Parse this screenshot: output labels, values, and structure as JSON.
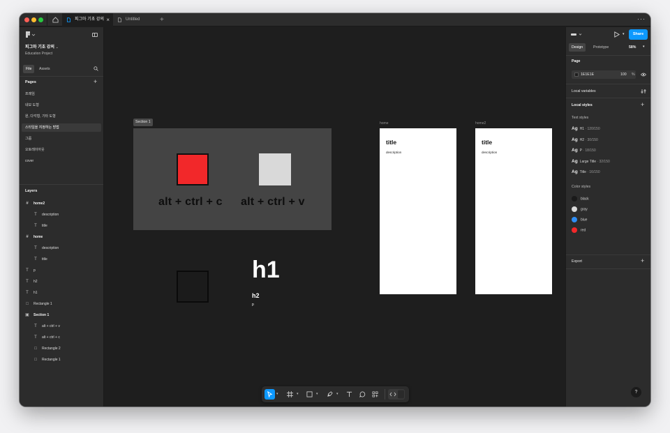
{
  "tabs": {
    "active_title": "피그마 기초 강의",
    "inactive_title": "Untitled",
    "add": "+",
    "close": "×",
    "more": "···"
  },
  "left": {
    "file_name": "피그마 기초 강의",
    "project": "Education Project",
    "file_tab": "File",
    "assets_tab": "Assets",
    "pages_title": "Pages",
    "pages": [
      "프레임",
      "네모 도형",
      "원, 다각형, 기타 도형",
      "스타일을 지정하는 방법",
      "그룹",
      "오토레이아웃",
      "cover"
    ],
    "selected_page_index": 3,
    "layers_title": "Layers",
    "layers": [
      {
        "name": "home2",
        "icon": "frame-icon",
        "glyph": "#",
        "bold": true
      },
      {
        "name": "description",
        "icon": "text-icon",
        "glyph": "T",
        "bold": false
      },
      {
        "name": "title",
        "icon": "text-icon",
        "glyph": "T",
        "bold": false
      },
      {
        "name": "home",
        "icon": "frame-icon",
        "glyph": "#",
        "bold": true
      },
      {
        "name": "description",
        "icon": "text-icon",
        "glyph": "T",
        "bold": false
      },
      {
        "name": "title",
        "icon": "text-icon",
        "glyph": "T",
        "bold": false
      },
      {
        "name": "p",
        "icon": "text-icon",
        "glyph": "T",
        "bold": false
      },
      {
        "name": "h2",
        "icon": "text-icon",
        "glyph": "T",
        "bold": false
      },
      {
        "name": "h1",
        "icon": "text-icon",
        "glyph": "T",
        "bold": false
      },
      {
        "name": "Rectangle 1",
        "icon": "rectangle-icon",
        "glyph": "□",
        "bold": false
      },
      {
        "name": "Section 1",
        "icon": "section-icon",
        "glyph": "▣",
        "bold": true
      },
      {
        "name": "alt + ctrl + v",
        "icon": "text-icon",
        "glyph": "T",
        "bold": false
      },
      {
        "name": "alt + ctrl + c",
        "icon": "text-icon",
        "glyph": "T",
        "bold": false
      },
      {
        "name": "Rectangle 2",
        "icon": "rectangle-icon",
        "glyph": "□",
        "bold": false
      },
      {
        "name": "Rectangle 1",
        "icon": "rectangle-icon",
        "glyph": "□",
        "bold": false
      }
    ],
    "layer_indent": [
      0,
      1,
      1,
      0,
      1,
      1,
      0,
      0,
      0,
      0,
      0,
      1,
      1,
      1,
      1
    ]
  },
  "canvas": {
    "section_label": "Section 1",
    "copy_text": "alt + ctrl + c",
    "paste_text": "alt + ctrl + v",
    "h1": "h1",
    "h2": "h2",
    "p": "p",
    "frame_home_label": "home",
    "frame_home2_label": "home2",
    "frame_title": "title",
    "frame_description": "description",
    "colors": {
      "red_rect": "#f2282a",
      "gray_rect": "#d9d9d9",
      "section_bg": "#444444",
      "canvas_bg": "#1e1e1e"
    }
  },
  "toolbar": {
    "tools": [
      "move-tool-icon",
      "frame-tool-icon",
      "rectangle-tool-icon",
      "pen-tool-icon",
      "text-tool-icon",
      "comment-tool-icon",
      "actions-icon",
      "dev-mode-icon"
    ],
    "selected_tool": "move-tool-icon"
  },
  "right": {
    "share": "Share",
    "design_tab": "Design",
    "prototype_tab": "Prototype",
    "zoom": "58%",
    "page_title": "Page",
    "page_color": "1E1E1E",
    "page_opacity": "100",
    "percent": "%",
    "local_variables": "Local variables",
    "local_styles": "Local styles",
    "text_styles_title": "Text styles",
    "text_styles": [
      {
        "ag": "Ag",
        "name": "H1",
        "meta": " · 120/150"
      },
      {
        "ag": "Ag",
        "name": "H2",
        "meta": " · 30/150"
      },
      {
        "ag": "Ag",
        "name": "P",
        "meta": " · 18/150"
      },
      {
        "ag": "Ag",
        "name": "Large Title",
        "meta": " · 32/150"
      },
      {
        "ag": "Ag",
        "name": "Title",
        "meta": " · 16/150"
      }
    ],
    "color_styles_title": "Color styles",
    "color_styles": [
      {
        "name": "black",
        "color": "#1a1a1a"
      },
      {
        "name": "gray",
        "color": "#d9d9d9"
      },
      {
        "name": "blue",
        "color": "#2f8ef5"
      },
      {
        "name": "red",
        "color": "#f2282a"
      }
    ],
    "export": "Export",
    "help": "?"
  }
}
